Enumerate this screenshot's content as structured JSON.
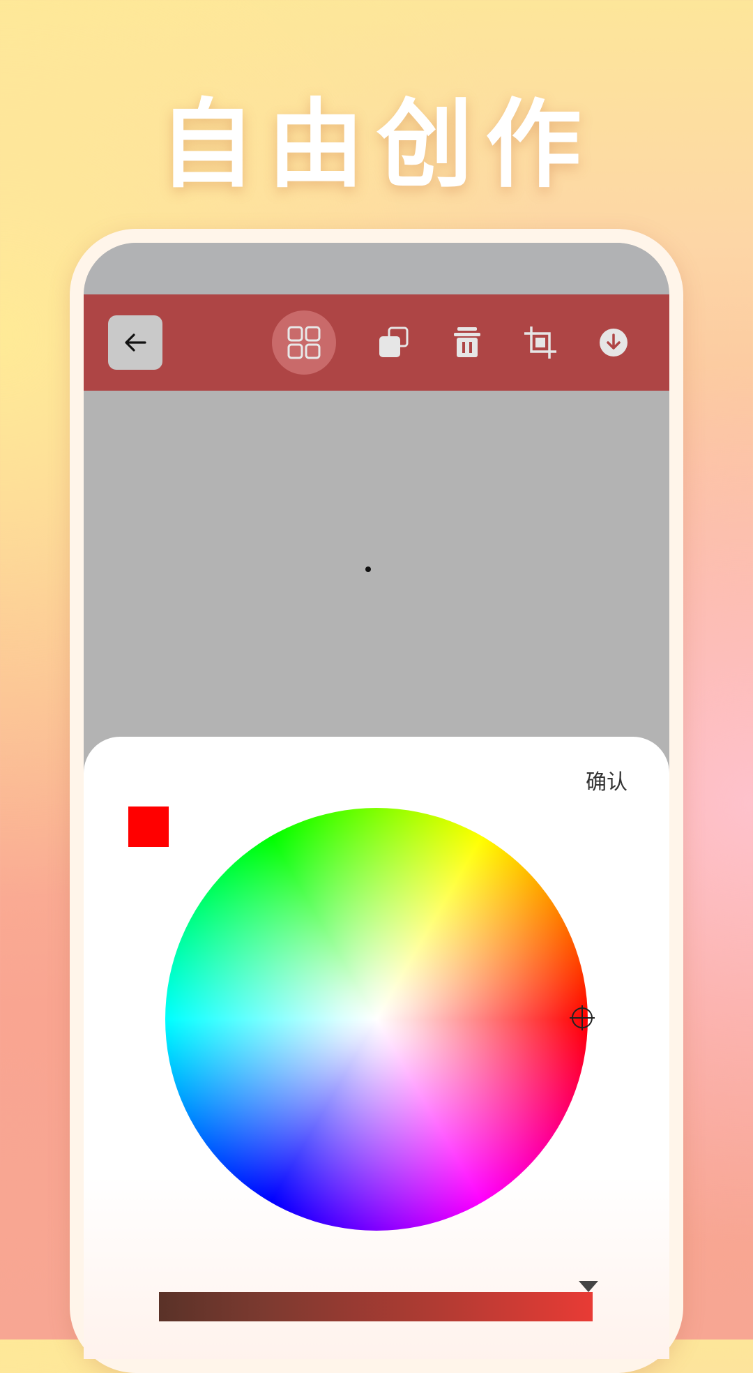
{
  "promo": {
    "headline": "自由创作"
  },
  "toolbar": {
    "back_icon": "arrow-left-icon",
    "layers_icon": "grid-icon",
    "copy_icon": "duplicate-icon",
    "trash_icon": "trash-icon",
    "crop_icon": "crop-icon",
    "download_icon": "download-icon",
    "accent_color": "#ae4545"
  },
  "color_picker": {
    "confirm_label": "确认",
    "selected_color": "#ff0000",
    "brightness_value": 1.0
  }
}
